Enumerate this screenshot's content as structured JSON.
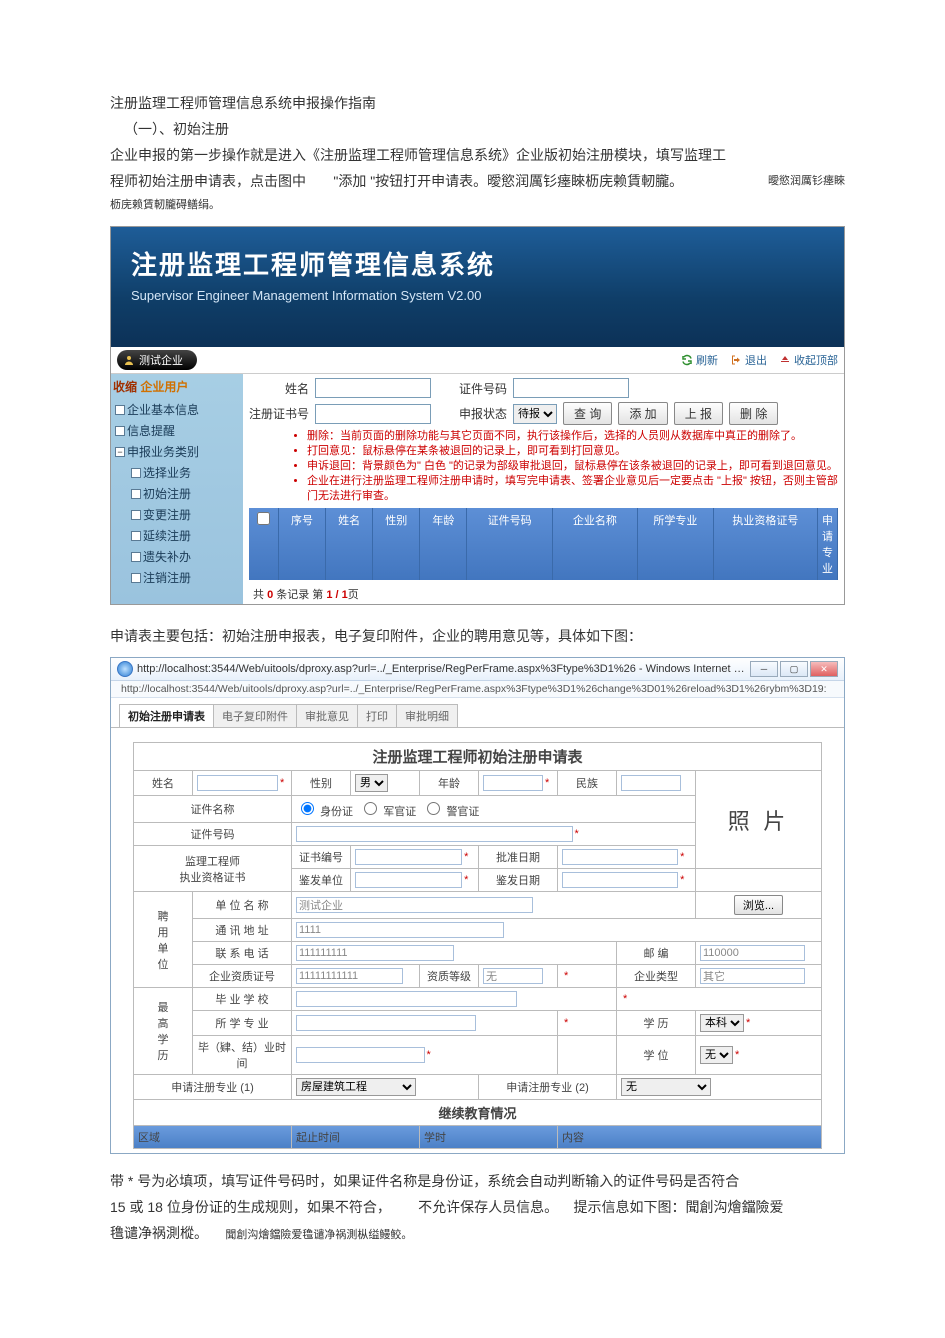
{
  "doc": {
    "title": "注册监理工程师管理信息系统申报操作指南",
    "section": "（一）、初始注册",
    "para1a": "企业申报的第一步操作就是进入《注册监理工程师管理信息系统》企业版初始注册模块，填写监理工",
    "para1b": "程师初始注册申请表，点击图中",
    "para1c": "\"添加 \"按钮打开申请表。曖慾润厲钐瘗睞枥庑赖賃軔朧。",
    "para1_extra": "曖慾润厲钐瘗睞",
    "para1_extra2": "枥庑赖賃軔朧碍鳝绢。",
    "between": "申请表主要包括：初始注册申报表，电子复印附件，企业的聘用意见等，具体如下图：",
    "final1": "带 * 号为必填项，填写证件号码时，如果证件名称是身份证，系统会自动判断输入的证件号码是否符合",
    "final2a": "15 或 18 位身份证的生成规则，如果不符合，",
    "final2b": "不允许保存人员信息。",
    "final2c": "提示信息如下图：聞創沟燴鐺險爱",
    "final3a": "氇谴净祸測樅。",
    "final3b": "聞創沟燴鐺險爱氇谴净祸測枞缢鳗鲛。"
  },
  "app1": {
    "banner_cn": "注册监理工程师管理信息系统",
    "banner_en": "Supervisor Engineer Management Information System V2.00",
    "user_label": "测试企业",
    "toolbar": {
      "refresh": "刷新",
      "exit": "退出",
      "collapse": "收起顶部"
    },
    "sidebar": {
      "caption_a": "收缩",
      "caption_b": "企业用户",
      "items": [
        {
          "label": "企业基本信息"
        },
        {
          "label": "信息提醒"
        },
        {
          "label": "申报业务类别",
          "group": true
        },
        {
          "label": "选择业务",
          "child": true
        },
        {
          "label": "初始注册",
          "child": true
        },
        {
          "label": "变更注册",
          "child": true
        },
        {
          "label": "延续注册",
          "child": true
        },
        {
          "label": "遗失补办",
          "child": true
        },
        {
          "label": "注销注册",
          "child": true
        }
      ]
    },
    "form": {
      "name": "姓名",
      "cert": "证件号码",
      "regno": "注册证书号",
      "status": "申报状态",
      "status_value": "待报",
      "btn_query": "查 询",
      "btn_add": "添 加",
      "btn_up": "上 报",
      "btn_del": "删 除"
    },
    "notes": [
      "删除：当前页面的删除功能与其它页面不同，执行该操作后，选择的人员则从数据库中真正的删除了。",
      "打回意见：鼠标悬停在某条被退回的记录上，即可看到打回意见。",
      "申诉退回：背景颜色为\" 白色 \"的记录为部级审批退回，鼠标悬停在该条被退回的记录上，即可看到退回意见。",
      "企业在进行注册监理工程师注册申请时，填写完申请表、签署企业意见后一定要点击 \"上报\" 按钮，否则主管部门无法进行审查。"
    ],
    "grid": {
      "cols": [
        "",
        "序号",
        "姓名",
        "性别",
        "年龄",
        "证件号码",
        "企业名称",
        "所学专业",
        "执业资格证号",
        "申请专业"
      ],
      "footer_a": "共 ",
      "footer_b": "0",
      "footer_c": " 条记录  第 ",
      "footer_d": "1 / 1",
      "footer_e": "页"
    }
  },
  "app2": {
    "title": "http://localhost:3544/Web/uitools/dproxy.asp?url=../_Enterprise/RegPerFrame.aspx%3Ftype%3D1%26 - Windows Internet Explorer",
    "addr": "http://localhost:3544/Web/uitools/dproxy.asp?url=../_Enterprise/RegPerFrame.aspx%3Ftype%3D1%26change%3D01%26reload%3D1%26rybm%3D19:",
    "tabs": [
      "初始注册申请表",
      "电子复印附件",
      "审批意见",
      "打印",
      "审批明细"
    ],
    "form_title": "注册监理工程师初始注册申请表",
    "labels": {
      "name": "姓名",
      "sex": "性别",
      "sex_val": "男",
      "age": "年龄",
      "nation": "民族",
      "doc_name": "证件名称",
      "doc_id": "身份证",
      "doc_off": "军官证",
      "doc_pol": "警官证",
      "doc_no": "证件号码",
      "photo": "照\n片",
      "qual": "监理工程师\n执业资格证书",
      "cert_no": "证书编号",
      "approve_date": "批准日期",
      "issuer": "鉴发单位",
      "issue_date": "鉴发日期",
      "employer": "聘\n用\n单\n位",
      "unit_name": "单 位 名 称",
      "unit_val": "测试企业",
      "addr": "通 讯 地 址",
      "addr_val": "1111",
      "tel": "联 系 电 话",
      "tel_val": "111111111",
      "post": "邮   编",
      "post_val": "110000",
      "ent_cert": "企业资质证号",
      "ent_cert_val": "11111111111",
      "grade": "资质等级",
      "grade_val": "无",
      "ent_type": "企业类型",
      "ent_type_val": "其它",
      "edu": "最\n高\n学\n历",
      "school": "毕 业 学 校",
      "major": "所 学 专 业",
      "degree_lbl": "学    历",
      "degree_val": "本科",
      "degree2_lbl": "学    位",
      "degree2_val": "无",
      "grad_time": "毕（肄、结）业时间",
      "apply1": "申请注册专业 (1)",
      "apply1_val": "房屋建筑工程",
      "apply2": "申请注册专业 (2)",
      "apply2_val": "无",
      "cont_title": "继续教育情况",
      "subcols": [
        "区域",
        "起止时间",
        "学时",
        "内容"
      ],
      "browse": "浏览..."
    }
  }
}
